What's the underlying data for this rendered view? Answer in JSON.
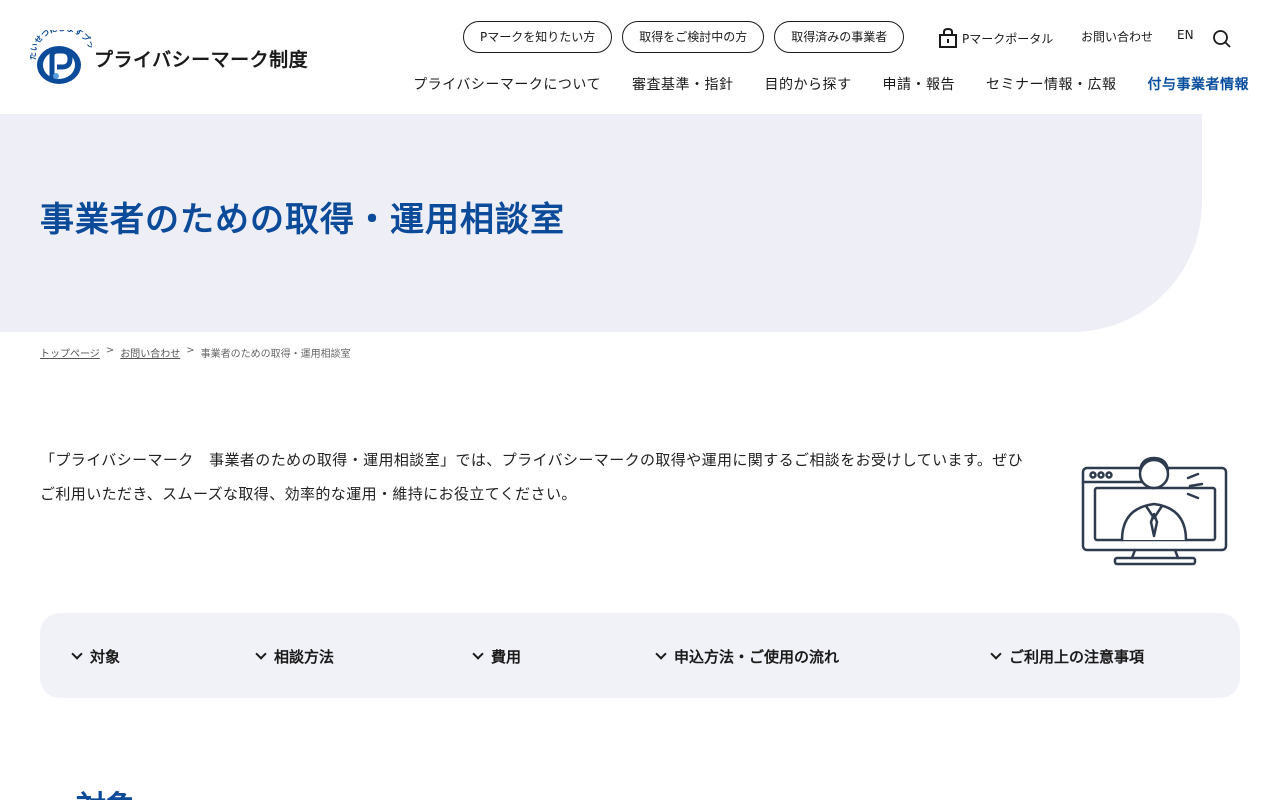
{
  "header": {
    "logo_arc_text": "たいせつにしますプライバシー",
    "site_name": "プライバシーマーク制度",
    "pills": [
      "Pマークを知りたい方",
      "取得をご検討中の方",
      "取得済みの事業者"
    ],
    "portal": "Pマークポータル",
    "contact": "お問い合わせ",
    "lang": "EN",
    "nav": [
      "プライバシーマークについて",
      "審査基準・指針",
      "目的から探す",
      "申請・報告",
      "セミナー情報・広報",
      "付与事業者情報"
    ]
  },
  "hero": {
    "title": "事業者のための取得・運用相談室"
  },
  "breadcrumb": {
    "home": "トップページ",
    "contact": "お問い合わせ",
    "current": "事業者のための取得・運用相談室",
    "sep": ">"
  },
  "intro": {
    "text": "「プライバシーマーク　事業者のための取得・運用相談室」では、プライバシーマークの取得や運用に関するご相談をお受けしています。ぜひご利用いただき、スムーズな取得、効率的な運用・維持にお役立てください。"
  },
  "anchors": [
    "対象",
    "相談方法",
    "費用",
    "申込方法・ご使用の流れ",
    "ご利用上の注意事項"
  ],
  "section": {
    "title": "対象"
  },
  "colors": {
    "brand_blue": "#0c4a9a",
    "hero_bg": "#edeef6",
    "anchor_bg": "#f1f2f8",
    "illus_stroke": "#2e3b4e"
  }
}
